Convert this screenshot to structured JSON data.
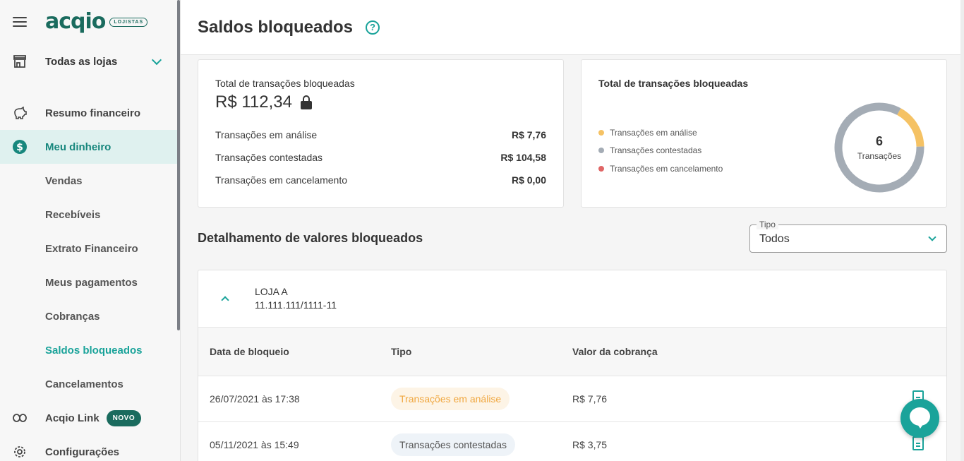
{
  "sidebar": {
    "logo": "acqio",
    "logo_badge": "LOJISTAS",
    "store_selector": "Todas as lojas",
    "items": [
      {
        "label": "Resumo financeiro"
      },
      {
        "label": "Meu dinheiro"
      }
    ],
    "sub_items": [
      {
        "label": "Vendas"
      },
      {
        "label": "Recebíveis"
      },
      {
        "label": "Extrato Financeiro"
      },
      {
        "label": "Meus pagamentos"
      },
      {
        "label": "Cobranças"
      },
      {
        "label": "Saldos bloqueados"
      },
      {
        "label": "Cancelamentos"
      }
    ],
    "bottom_items": [
      {
        "label": "Acqio Link",
        "badge": "NOVO"
      },
      {
        "label": "Configurações"
      }
    ]
  },
  "header": {
    "title": "Saldos bloqueados",
    "help": "?"
  },
  "summary": {
    "title": "Total de transações bloqueadas",
    "total": "R$ 112,34",
    "rows": [
      {
        "label": "Transações em análise",
        "value": "R$ 7,76"
      },
      {
        "label": "Transações contestadas",
        "value": "R$ 104,58"
      },
      {
        "label": "Transações em cancelamento",
        "value": "R$ 0,00"
      }
    ]
  },
  "chart_card": {
    "title": "Total de transações bloqueadas",
    "center_value": "6",
    "center_label": "Transações"
  },
  "chart_data": {
    "type": "pie",
    "categories": [
      "Transações em análise",
      "Transações contestadas",
      "Transações em cancelamento"
    ],
    "values": [
      1,
      5,
      0
    ],
    "colors": [
      "#f5c264",
      "#a4acb5",
      "#e06666"
    ],
    "legend": "left"
  },
  "detail": {
    "title": "Detalhamento de valores bloqueados",
    "filter_label": "Tipo",
    "filter_value": "Todos",
    "store_name": "LOJA A",
    "store_doc": "11.111.111/1111-11",
    "columns": [
      "Data de bloqueio",
      "Tipo",
      "Valor da cobrança"
    ],
    "rows": [
      {
        "date": "26/07/2021 às 17:38",
        "type": "Transações em análise",
        "value": "R$ 7,76"
      },
      {
        "date": "05/11/2021 às 15:49",
        "type": "Transações contestadas",
        "value": "R$ 3,75"
      }
    ]
  },
  "colors": {
    "accent": "#1aa39a",
    "brand": "#1a6b5e"
  }
}
